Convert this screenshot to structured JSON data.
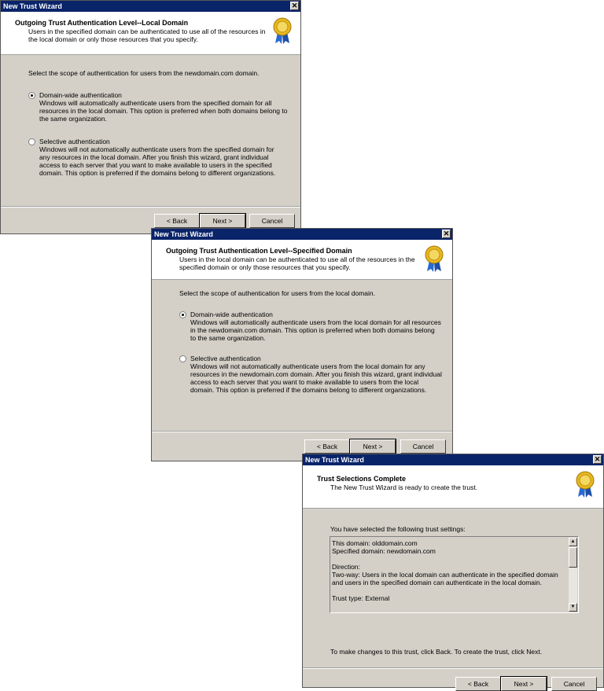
{
  "window_title": "New Trust Wizard",
  "close_glyph": "✕",
  "dialog1": {
    "title": "Outgoing Trust Authentication Level--Local Domain",
    "subtitle": "Users in the specified domain can be authenticated to use all of the resources in the local domain or only those resources that you specify.",
    "prompt": "Select the scope of authentication for users from the newdomain.com domain.",
    "option1_label": "Domain-wide authentication",
    "option1_desc": "Windows will automatically authenticate users from the specified domain for all resources in the local domain. This option is preferred when both domains belong to the same organization.",
    "option2_label": "Selective authentication",
    "option2_desc": "Windows will not automatically authenticate users from the specified domain for any resources in the local domain. After you finish this wizard, grant individual access to each server that you want to make available to users in the specified domain. This option is preferred if the domains belong to different organizations.",
    "selected": "option1",
    "back": "< Back",
    "next": "Next >",
    "cancel": "Cancel"
  },
  "dialog2": {
    "title": "Outgoing Trust Authentication Level--Specified Domain",
    "subtitle": "Users in the local domain can be authenticated to use all of the resources in the specified domain or only those resources that you specify.",
    "prompt": "Select the scope of authentication for users from the local domain.",
    "option1_label": "Domain-wide authentication",
    "option1_desc": "Windows will automatically authenticate users from the local domain for all resources in the newdomain.com domain. This option is preferred when both domains belong to the same organization.",
    "option2_label": "Selective authentication",
    "option2_desc": "Windows will not automatically authenticate users from the local domain for any resources in the newdomain.com domain. After you finish this wizard, grant individual access to each server that you want to make available to users from the local domain. This option is preferred if the domains belong to different organizations.",
    "selected": "option1",
    "back": "< Back",
    "next": "Next >",
    "cancel": "Cancel"
  },
  "dialog3": {
    "title": "Trust Selections Complete",
    "subtitle": "The New Trust Wizard is ready to create the trust.",
    "prompt": "You have selected the following trust settings:",
    "settings": {
      "this_domain": "This domain: olddomain.com",
      "specified_domain": "Specified domain: newdomain.com",
      "direction_label": "Direction:",
      "direction_value": "Two-way: Users in the local domain can authenticate in the specified domain and users in the specified domain can authenticate in the local domain.",
      "trust_type": "Trust type: External"
    },
    "footer_note": "To make changes to this trust, click Back. To create the trust, click Next.",
    "back": "< Back",
    "next": "Next >",
    "cancel": "Cancel"
  },
  "colors": {
    "titlebar": "#0a246a",
    "dialog_bg": "#d4d0c8",
    "header_bg": "#ffffff"
  },
  "icons": {
    "badge": "award-ribbon-icon",
    "close": "close-icon"
  }
}
